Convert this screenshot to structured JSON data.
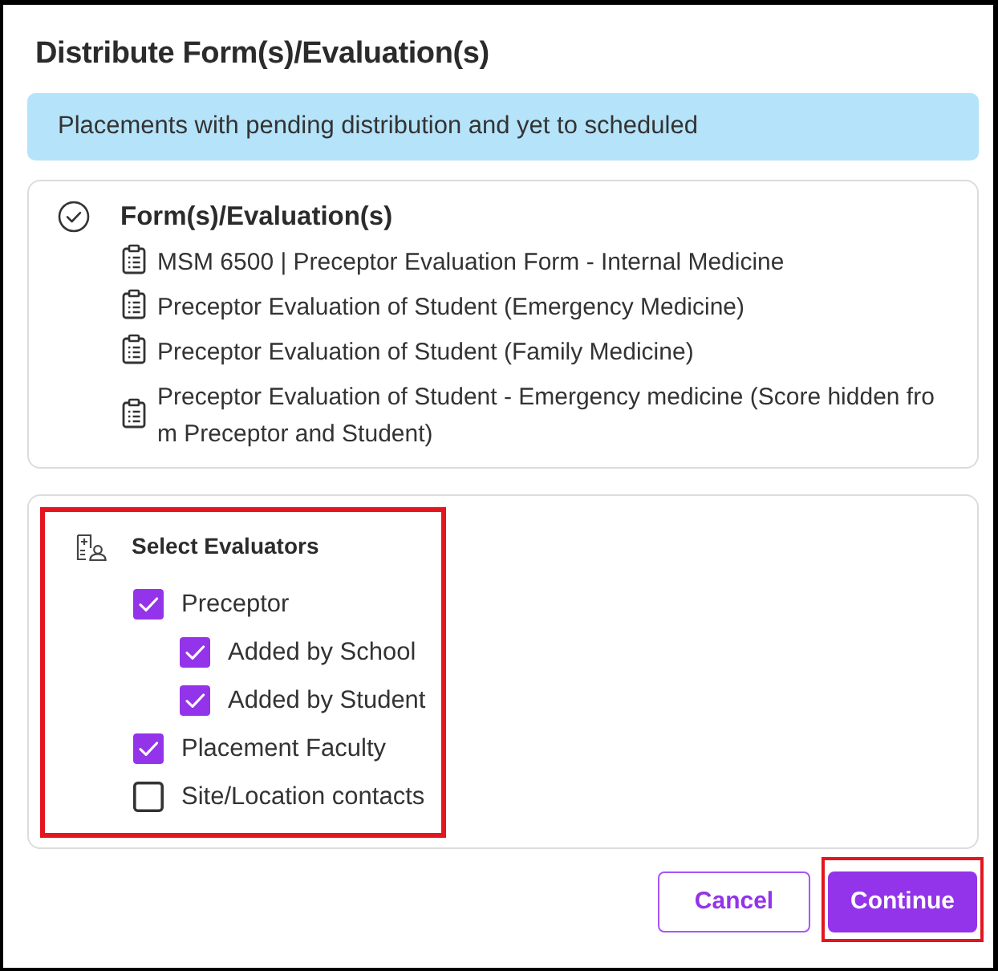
{
  "dialog": {
    "title": "Distribute Form(s)/Evaluation(s)"
  },
  "notice": {
    "text": "Placements with pending distribution and yet to scheduled"
  },
  "forms_section": {
    "heading": "Form(s)/Evaluation(s)",
    "items": [
      "MSM 6500 | Preceptor Evaluation Form - Internal Medicine",
      "Preceptor Evaluation of Student (Emergency Medicine)",
      "Preceptor Evaluation of Student (Family Medicine)",
      "Preceptor Evaluation of Student - Emergency medicine (Score hidden from Preceptor and Student)"
    ]
  },
  "evaluators_section": {
    "heading": "Select Evaluators",
    "highlighted": true,
    "options": [
      {
        "label": "Preceptor",
        "checked": true,
        "children": [
          {
            "label": "Added by School",
            "checked": true
          },
          {
            "label": "Added by Student",
            "checked": true
          }
        ]
      },
      {
        "label": "Placement Faculty",
        "checked": true
      },
      {
        "label": "Site/Location contacts",
        "checked": false
      }
    ]
  },
  "buttons": [
    {
      "label": "Cancel",
      "kind": "outline",
      "highlighted": false
    },
    {
      "label": "Continue",
      "kind": "primary",
      "highlighted": true
    }
  ]
}
